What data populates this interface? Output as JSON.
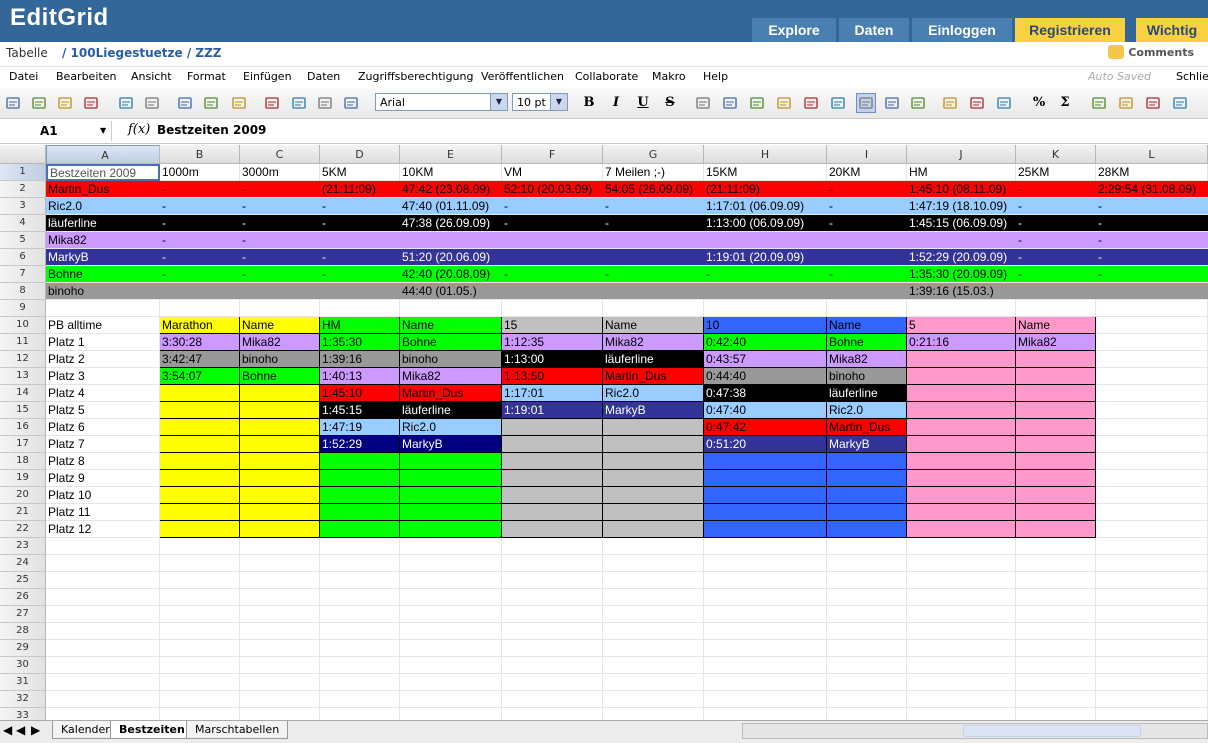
{
  "app": {
    "logo": "EditGrid"
  },
  "nav": [
    {
      "label": "Explore",
      "style": "blue"
    },
    {
      "label": "Daten",
      "style": "blue"
    },
    {
      "label": "Einloggen",
      "style": "blue"
    },
    {
      "label": "Registrieren",
      "style": "yellow"
    },
    {
      "label": "Wichtig",
      "style": "yellow"
    }
  ],
  "path": {
    "label": "Tabelle",
    "path": "/ 100Liegestuetze / ZZZ",
    "comments": "Comments"
  },
  "menu": {
    "items": [
      "Datei",
      "Bearbeiten",
      "Ansicht",
      "Format",
      "Einfügen",
      "Daten",
      "Zugriffsberechtigung",
      "Veröffentlichen",
      "Collaborate",
      "Makro",
      "Help"
    ],
    "autosaved": "Auto Saved",
    "close": "Schließ"
  },
  "toolbar": {
    "font": "Arial",
    "size": "10 pt",
    "icons": [
      "cut-icon",
      "copy-icon",
      "paste-icon",
      "format-painter-icon",
      "undo-icon",
      "redo-icon",
      "find-icon",
      "print-icon",
      "download-icon",
      "sort-icon",
      "refresh-icon",
      "chart-icon",
      "plugin-icon",
      "bold-icon",
      "italic-icon",
      "underline-icon",
      "strikethrough-icon",
      "align-left-icon",
      "align-center-icon",
      "align-right-icon",
      "justify-icon",
      "valign-top-icon",
      "valign-middle-icon",
      "valign-bottom-icon",
      "borders-icon",
      "wrap-icon",
      "freeze-icon",
      "fill-color-icon",
      "font-color-icon",
      "number-format-icon",
      "sum-icon",
      "insert-row-icon",
      "delete-row-icon",
      "insert-column-icon",
      "delete-column-icon"
    ]
  },
  "formula": {
    "ref": "A1",
    "fx": "f(x)",
    "value": "Bestzeiten 2009"
  },
  "columns": [
    "A",
    "B",
    "C",
    "D",
    "E",
    "F",
    "G",
    "H",
    "I",
    "J",
    "K",
    "L"
  ],
  "rows": [
    {
      "n": "1",
      "cells": [
        "Bestzeiten 2009",
        "1000m",
        "3000m",
        "5KM",
        "10KM",
        "VM",
        "7 Meilen ;-)",
        "15KM",
        "20KM",
        "HM",
        "25KM",
        "28KM"
      ]
    },
    {
      "n": "2",
      "cells": [
        "Martin_Dus",
        "-",
        "-",
        "(21:11:09)",
        "47:42 (23.08.09)",
        "52:10 (20.03.09)",
        "54:05 (26.09.09)",
        "(21:11:09)",
        "-",
        "1:45:10 (08.11.09)",
        "-",
        "2:29:54 (31.08.09)"
      ]
    },
    {
      "n": "3",
      "cells": [
        "Ric2.0",
        "-",
        "-",
        "-",
        "47:40 (01.11.09)",
        "-",
        "-",
        "1:17:01 (06.09.09)",
        "-",
        "1:47:19 (18.10.09)",
        "-",
        "-"
      ]
    },
    {
      "n": "4",
      "cells": [
        "läuferline",
        "-",
        "-",
        "-",
        "47:38 (26.09.09)",
        "-",
        "-",
        "1:13:00 (06.09.09)",
        "-",
        "1:45:15 (06.09.09)",
        "-",
        "-"
      ]
    },
    {
      "n": "5",
      "cells": [
        "Mika82",
        "-",
        "-",
        "",
        "",
        "",
        "",
        "",
        "",
        "",
        "-",
        "-"
      ]
    },
    {
      "n": "6",
      "cells": [
        "MarkyB",
        "-",
        "-",
        "-",
        "51:20 (20.06.09)",
        "",
        "",
        "1:19:01 (20.09.09)",
        "",
        "1:52:29 (20.09.09)",
        "-",
        "-"
      ]
    },
    {
      "n": "7",
      "cells": [
        "Bohne",
        "-",
        "-",
        "-",
        "42:40 (20.08.09)",
        "-",
        "-",
        "-",
        "-",
        "1:35:30 (20.09.09)",
        "-",
        "-"
      ]
    },
    {
      "n": "8",
      "cells": [
        "binoho",
        "",
        "",
        "",
        "44:40  (01.05.)",
        "",
        "",
        "",
        "",
        "1:39:16 (15.03.)",
        "",
        ""
      ]
    },
    {
      "n": "9",
      "cells": [
        "",
        "",
        "",
        "",
        "",
        "",
        "",
        "",
        "",
        "",
        "",
        ""
      ]
    },
    {
      "n": "10",
      "cells": [
        "PB alltime",
        "Marathon",
        "Name",
        "HM",
        "Name",
        "15",
        "Name",
        "10",
        "Name",
        "5",
        "Name",
        ""
      ]
    },
    {
      "n": "11",
      "cells": [
        "Platz 1",
        "3:30:28",
        "Mika82",
        "1:35:30",
        "Bohne",
        "1:12:35",
        "Mika82",
        "0:42:40",
        "Bohne",
        "0:21:16",
        "Mika82",
        ""
      ]
    },
    {
      "n": "12",
      "cells": [
        "Platz 2",
        "3:42:47",
        "binoho",
        "1:39:16",
        "binoho",
        "1:13:00",
        "läuferline",
        "0:43:57",
        "Mika82",
        "",
        "",
        ""
      ]
    },
    {
      "n": "13",
      "cells": [
        "Platz 3",
        "3:54:07",
        "Bohne",
        "1:40:13",
        "Mika82",
        "1:13:50",
        "Martin_Dus",
        "0:44:40",
        "binoho",
        "",
        "",
        ""
      ]
    },
    {
      "n": "14",
      "cells": [
        "Platz 4",
        "",
        "",
        "1:45:10",
        "Martin_Dus",
        "1:17:01",
        "Ric2.0",
        "0:47:38",
        "läuferline",
        "",
        "",
        ""
      ]
    },
    {
      "n": "15",
      "cells": [
        "Platz 5",
        "",
        "",
        "1:45:15",
        "läuferline",
        "1:19:01",
        "MarkyB",
        "0:47:40",
        "Ric2.0",
        "",
        "",
        ""
      ]
    },
    {
      "n": "16",
      "cells": [
        "Platz 6",
        "",
        "",
        "1:47:19",
        "Ric2.0",
        "",
        "",
        "0:47:42",
        "Martin_Dus",
        "",
        "",
        ""
      ]
    },
    {
      "n": "17",
      "cells": [
        "Platz 7",
        "",
        "",
        "1:52:29",
        "MarkyB",
        "",
        "",
        "0:51:20",
        "MarkyB",
        "",
        "",
        ""
      ]
    },
    {
      "n": "18",
      "cells": [
        "Platz 8",
        "",
        "",
        "",
        "",
        "",
        "",
        "",
        "",
        "",
        "",
        ""
      ]
    },
    {
      "n": "19",
      "cells": [
        "Platz 9",
        "",
        "",
        "",
        "",
        "",
        "",
        "",
        "",
        "",
        "",
        ""
      ]
    },
    {
      "n": "20",
      "cells": [
        "Platz 10",
        "",
        "",
        "",
        "",
        "",
        "",
        "",
        "",
        "",
        "",
        ""
      ]
    },
    {
      "n": "21",
      "cells": [
        "Platz 11",
        "",
        "",
        "",
        "",
        "",
        "",
        "",
        "",
        "",
        "",
        ""
      ]
    },
    {
      "n": "22",
      "cells": [
        "Platz 12",
        "",
        "",
        "",
        "",
        "",
        "",
        "",
        "",
        "",
        "",
        ""
      ]
    },
    {
      "n": "23",
      "cells": [
        "",
        "",
        "",
        "",
        "",
        "",
        "",
        "",
        "",
        "",
        "",
        ""
      ]
    },
    {
      "n": "24",
      "cells": [
        "",
        "",
        "",
        "",
        "",
        "",
        "",
        "",
        "",
        "",
        "",
        ""
      ]
    },
    {
      "n": "25",
      "cells": [
        "",
        "",
        "",
        "",
        "",
        "",
        "",
        "",
        "",
        "",
        "",
        ""
      ]
    },
    {
      "n": "26",
      "cells": [
        "",
        "",
        "",
        "",
        "",
        "",
        "",
        "",
        "",
        "",
        "",
        ""
      ]
    },
    {
      "n": "27",
      "cells": [
        "",
        "",
        "",
        "",
        "",
        "",
        "",
        "",
        "",
        "",
        "",
        ""
      ]
    },
    {
      "n": "28",
      "cells": [
        "",
        "",
        "",
        "",
        "",
        "",
        "",
        "",
        "",
        "",
        "",
        ""
      ]
    },
    {
      "n": "29",
      "cells": [
        "",
        "",
        "",
        "",
        "",
        "",
        "",
        "",
        "",
        "",
        "",
        ""
      ]
    },
    {
      "n": "30",
      "cells": [
        "",
        "",
        "",
        "",
        "",
        "",
        "",
        "",
        "",
        "",
        "",
        ""
      ]
    },
    {
      "n": "31",
      "cells": [
        "",
        "",
        "",
        "",
        "",
        "",
        "",
        "",
        "",
        "",
        "",
        ""
      ]
    },
    {
      "n": "32",
      "cells": [
        "",
        "",
        "",
        "",
        "",
        "",
        "",
        "",
        "",
        "",
        "",
        ""
      ]
    },
    {
      "n": "33",
      "cells": [
        "",
        "",
        "",
        "",
        "",
        "",
        "",
        "",
        "",
        "",
        "",
        ""
      ]
    }
  ],
  "colors": {
    "red": "#ff0000",
    "lightblue": "#99ccff",
    "black": "#000000",
    "lavender": "#cc99ff",
    "indigo": "#333399",
    "green": "#00ff00",
    "gray": "#999999",
    "yellow": "#ffff00",
    "silver": "#c0c0c0",
    "blue": "#3366ff",
    "pink": "#ff99cc",
    "navy": "#000080",
    "accent": "#336699",
    "tabyellow": "#f8d040"
  },
  "sheets": [
    {
      "label": "Kalender",
      "active": false
    },
    {
      "label": "Bestzeiten",
      "active": true
    },
    {
      "label": "Marschtabellen",
      "active": false
    }
  ]
}
